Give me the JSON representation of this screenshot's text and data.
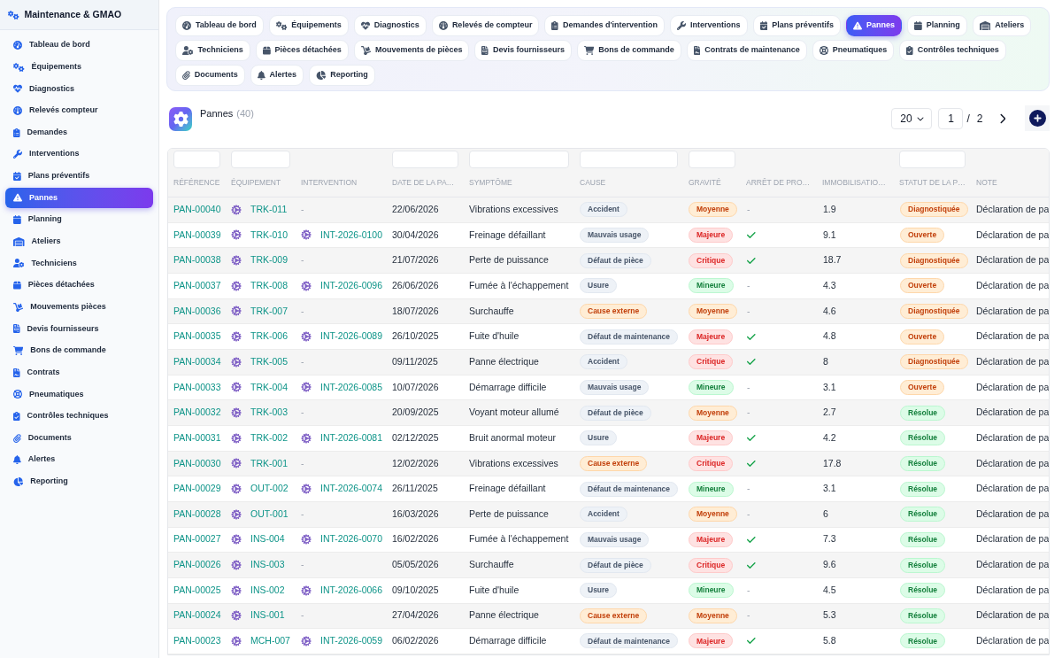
{
  "sidebar": {
    "title": "Maintenance & GMAO",
    "items": [
      {
        "label": "Tableau de bord",
        "selected": false
      },
      {
        "label": "Équipements",
        "selected": false
      },
      {
        "label": "Diagnostics",
        "selected": false
      },
      {
        "label": "Relevés compteur",
        "selected": false
      },
      {
        "label": "Demandes",
        "selected": false
      },
      {
        "label": "Interventions",
        "selected": false
      },
      {
        "label": "Plans préventifs",
        "selected": false
      },
      {
        "label": "Pannes",
        "selected": true
      },
      {
        "label": "Planning",
        "selected": false
      },
      {
        "label": "Ateliers",
        "selected": false
      },
      {
        "label": "Techniciens",
        "selected": false
      },
      {
        "label": "Pièces détachées",
        "selected": false
      },
      {
        "label": "Mouvements pièces",
        "selected": false
      },
      {
        "label": "Devis fournisseurs",
        "selected": false
      },
      {
        "label": "Bons de commande",
        "selected": false
      },
      {
        "label": "Contrats",
        "selected": false
      },
      {
        "label": "Pneumatiques",
        "selected": false
      },
      {
        "label": "Contrôles techniques",
        "selected": false
      },
      {
        "label": "Documents",
        "selected": false
      },
      {
        "label": "Alertes",
        "selected": false
      },
      {
        "label": "Reporting",
        "selected": false
      }
    ]
  },
  "tabs": [
    {
      "label": "Tableau de bord",
      "selected": false
    },
    {
      "label": "Équipements",
      "selected": false
    },
    {
      "label": "Diagnostics",
      "selected": false
    },
    {
      "label": "Relevés de compteur",
      "selected": false
    },
    {
      "label": "Demandes d'intervention",
      "selected": false
    },
    {
      "label": "Interventions",
      "selected": false
    },
    {
      "label": "Plans préventifs",
      "selected": false
    },
    {
      "label": "Pannes",
      "selected": true
    },
    {
      "label": "Planning",
      "selected": false
    },
    {
      "label": "Ateliers",
      "selected": false
    },
    {
      "label": "Techniciens",
      "selected": false
    },
    {
      "label": "Pièces détachées",
      "selected": false
    },
    {
      "label": "Mouvements de pièces",
      "selected": false
    },
    {
      "label": "Devis fournisseurs",
      "selected": false
    },
    {
      "label": "Bons de commande",
      "selected": false
    },
    {
      "label": "Contrats de maintenance",
      "selected": false
    },
    {
      "label": "Pneumatiques",
      "selected": false
    },
    {
      "label": "Contrôles techniques",
      "selected": false
    },
    {
      "label": "Documents",
      "selected": false
    },
    {
      "label": "Alertes",
      "selected": false
    },
    {
      "label": "Reporting",
      "selected": false
    }
  ],
  "page": {
    "title": "Pannes",
    "count": "(40)",
    "page_size": "20",
    "page": "1",
    "separator": "/",
    "total_pages": "2"
  },
  "table": {
    "columns": [
      {
        "label": "RÉFÉRENCE",
        "filter": true
      },
      {
        "label": "ÉQUIPEMENT",
        "filter": true
      },
      {
        "label": "INTERVENTION",
        "filter": false
      },
      {
        "label": "DATE DE LA PA…",
        "filter": true
      },
      {
        "label": "SYMPTÔME",
        "filter": true
      },
      {
        "label": "CAUSE",
        "filter": true
      },
      {
        "label": "GRAVITÉ",
        "filter": true
      },
      {
        "label": "ARRÊT DE PRO…",
        "filter": false
      },
      {
        "label": "IMMOBILISATIO…",
        "filter": false
      },
      {
        "label": "STATUT DE LA P…",
        "filter": true
      },
      {
        "label": "NOTE",
        "filter": false
      }
    ],
    "rows": [
      {
        "reference": "PAN-00040",
        "equipment": "TRK-011",
        "intervention": {
          "kind": "none",
          "text": "-"
        },
        "date": "22/06/2026",
        "symptom": "Vibrations excessives",
        "cause": {
          "text": "Accident",
          "kind": "neutral"
        },
        "severity": {
          "text": "Moyenne",
          "kind": "warning"
        },
        "production_stop": false,
        "production_stop_text": "-",
        "downtime": "1.9",
        "status": {
          "text": "Diagnostiquée",
          "kind": "warning"
        },
        "note": "Déclaration de pa"
      },
      {
        "reference": "PAN-00039",
        "equipment": "TRK-010",
        "intervention": {
          "kind": "link",
          "text": "INT-2026-0100"
        },
        "date": "30/04/2026",
        "symptom": "Freinage défaillant",
        "cause": {
          "text": "Mauvais usage",
          "kind": "neutral"
        },
        "severity": {
          "text": "Majeure",
          "kind": "danger"
        },
        "production_stop": true,
        "downtime": "9.1",
        "status": {
          "text": "Ouverte",
          "kind": "warning"
        },
        "note": "Déclaration de pa"
      },
      {
        "reference": "PAN-00038",
        "equipment": "TRK-009",
        "intervention": {
          "kind": "none",
          "text": "-"
        },
        "date": "21/07/2026",
        "symptom": "Perte de puissance",
        "cause": {
          "text": "Défaut de pièce",
          "kind": "neutral"
        },
        "severity": {
          "text": "Critique",
          "kind": "danger"
        },
        "production_stop": true,
        "downtime": "18.7",
        "status": {
          "text": "Diagnostiquée",
          "kind": "warning"
        },
        "note": "Déclaration de pa"
      },
      {
        "reference": "PAN-00037",
        "equipment": "TRK-008",
        "intervention": {
          "kind": "link",
          "text": "INT-2026-0096"
        },
        "date": "26/06/2026",
        "symptom": "Fumée à l'échappement",
        "cause": {
          "text": "Usure",
          "kind": "neutral"
        },
        "severity": {
          "text": "Mineure",
          "kind": "success"
        },
        "production_stop": false,
        "production_stop_text": "-",
        "downtime": "4.3",
        "status": {
          "text": "Ouverte",
          "kind": "warning"
        },
        "note": "Déclaration de pa"
      },
      {
        "reference": "PAN-00036",
        "equipment": "TRK-007",
        "intervention": {
          "kind": "none",
          "text": "-"
        },
        "date": "18/07/2026",
        "symptom": "Surchauffe",
        "cause": {
          "text": "Cause externe",
          "kind": "warning"
        },
        "severity": {
          "text": "Moyenne",
          "kind": "warning"
        },
        "production_stop": false,
        "production_stop_text": "-",
        "downtime": "4.6",
        "status": {
          "text": "Diagnostiquée",
          "kind": "warning"
        },
        "note": "Déclaration de pa"
      },
      {
        "reference": "PAN-00035",
        "equipment": "TRK-006",
        "intervention": {
          "kind": "link",
          "text": "INT-2026-0089"
        },
        "date": "26/10/2025",
        "symptom": "Fuite d'huile",
        "cause": {
          "text": "Défaut de maintenance",
          "kind": "neutral"
        },
        "severity": {
          "text": "Majeure",
          "kind": "danger"
        },
        "production_stop": true,
        "downtime": "4.8",
        "status": {
          "text": "Ouverte",
          "kind": "warning"
        },
        "note": "Déclaration de pa"
      },
      {
        "reference": "PAN-00034",
        "equipment": "TRK-005",
        "intervention": {
          "kind": "none",
          "text": "-"
        },
        "date": "09/11/2025",
        "symptom": "Panne électrique",
        "cause": {
          "text": "Accident",
          "kind": "neutral"
        },
        "severity": {
          "text": "Critique",
          "kind": "danger"
        },
        "production_stop": true,
        "downtime": "8",
        "status": {
          "text": "Diagnostiquée",
          "kind": "warning"
        },
        "note": "Déclaration de pa"
      },
      {
        "reference": "PAN-00033",
        "equipment": "TRK-004",
        "intervention": {
          "kind": "link",
          "text": "INT-2026-0085"
        },
        "date": "10/07/2026",
        "symptom": "Démarrage difficile",
        "cause": {
          "text": "Mauvais usage",
          "kind": "neutral"
        },
        "severity": {
          "text": "Mineure",
          "kind": "success"
        },
        "production_stop": false,
        "production_stop_text": "-",
        "downtime": "3.1",
        "status": {
          "text": "Ouverte",
          "kind": "warning"
        },
        "note": "Déclaration de pa"
      },
      {
        "reference": "PAN-00032",
        "equipment": "TRK-003",
        "intervention": {
          "kind": "none",
          "text": "-"
        },
        "date": "20/09/2025",
        "symptom": "Voyant moteur allumé",
        "cause": {
          "text": "Défaut de pièce",
          "kind": "neutral"
        },
        "severity": {
          "text": "Moyenne",
          "kind": "warning"
        },
        "production_stop": false,
        "production_stop_text": "-",
        "downtime": "2.7",
        "status": {
          "text": "Résolue",
          "kind": "success"
        },
        "note": "Déclaration de pa"
      },
      {
        "reference": "PAN-00031",
        "equipment": "TRK-002",
        "intervention": {
          "kind": "link",
          "text": "INT-2026-0081"
        },
        "date": "02/12/2025",
        "symptom": "Bruit anormal moteur",
        "cause": {
          "text": "Usure",
          "kind": "neutral"
        },
        "severity": {
          "text": "Majeure",
          "kind": "danger"
        },
        "production_stop": true,
        "downtime": "4.2",
        "status": {
          "text": "Résolue",
          "kind": "success"
        },
        "note": "Déclaration de pa"
      },
      {
        "reference": "PAN-00030",
        "equipment": "TRK-001",
        "intervention": {
          "kind": "none",
          "text": "-"
        },
        "date": "12/02/2026",
        "symptom": "Vibrations excessives",
        "cause": {
          "text": "Cause externe",
          "kind": "warning"
        },
        "severity": {
          "text": "Critique",
          "kind": "danger"
        },
        "production_stop": true,
        "downtime": "17.8",
        "status": {
          "text": "Résolue",
          "kind": "success"
        },
        "note": "Déclaration de pa"
      },
      {
        "reference": "PAN-00029",
        "equipment": "OUT-002",
        "intervention": {
          "kind": "link",
          "text": "INT-2026-0074"
        },
        "date": "26/11/2025",
        "symptom": "Freinage défaillant",
        "cause": {
          "text": "Défaut de maintenance",
          "kind": "neutral"
        },
        "severity": {
          "text": "Mineure",
          "kind": "success"
        },
        "production_stop": false,
        "production_stop_text": "-",
        "downtime": "3.1",
        "status": {
          "text": "Résolue",
          "kind": "success"
        },
        "note": "Déclaration de pa"
      },
      {
        "reference": "PAN-00028",
        "equipment": "OUT-001",
        "intervention": {
          "kind": "none",
          "text": "-"
        },
        "date": "16/03/2026",
        "symptom": "Perte de puissance",
        "cause": {
          "text": "Accident",
          "kind": "neutral"
        },
        "severity": {
          "text": "Moyenne",
          "kind": "warning"
        },
        "production_stop": false,
        "production_stop_text": "-",
        "downtime": "6",
        "status": {
          "text": "Résolue",
          "kind": "success"
        },
        "note": "Déclaration de pa"
      },
      {
        "reference": "PAN-00027",
        "equipment": "INS-004",
        "intervention": {
          "kind": "link",
          "text": "INT-2026-0070"
        },
        "date": "16/02/2026",
        "symptom": "Fumée à l'échappement",
        "cause": {
          "text": "Mauvais usage",
          "kind": "neutral"
        },
        "severity": {
          "text": "Majeure",
          "kind": "danger"
        },
        "production_stop": true,
        "downtime": "7.3",
        "status": {
          "text": "Résolue",
          "kind": "success"
        },
        "note": "Déclaration de pa"
      },
      {
        "reference": "PAN-00026",
        "equipment": "INS-003",
        "intervention": {
          "kind": "none",
          "text": "-"
        },
        "date": "05/05/2026",
        "symptom": "Surchauffe",
        "cause": {
          "text": "Défaut de pièce",
          "kind": "neutral"
        },
        "severity": {
          "text": "Critique",
          "kind": "danger"
        },
        "production_stop": true,
        "downtime": "9.6",
        "status": {
          "text": "Résolue",
          "kind": "success"
        },
        "note": "Déclaration de pa"
      },
      {
        "reference": "PAN-00025",
        "equipment": "INS-002",
        "intervention": {
          "kind": "link",
          "text": "INT-2026-0066"
        },
        "date": "09/10/2025",
        "symptom": "Fuite d'huile",
        "cause": {
          "text": "Usure",
          "kind": "neutral"
        },
        "severity": {
          "text": "Mineure",
          "kind": "success"
        },
        "production_stop": false,
        "production_stop_text": "-",
        "downtime": "4.5",
        "status": {
          "text": "Résolue",
          "kind": "success"
        },
        "note": "Déclaration de pa"
      },
      {
        "reference": "PAN-00024",
        "equipment": "INS-001",
        "intervention": {
          "kind": "none",
          "text": "-"
        },
        "date": "27/04/2026",
        "symptom": "Panne électrique",
        "cause": {
          "text": "Cause externe",
          "kind": "warning"
        },
        "severity": {
          "text": "Moyenne",
          "kind": "warning"
        },
        "production_stop": false,
        "production_stop_text": "-",
        "downtime": "5.3",
        "status": {
          "text": "Résolue",
          "kind": "success"
        },
        "note": "Déclaration de pa"
      },
      {
        "reference": "PAN-00023",
        "equipment": "MCH-007",
        "intervention": {
          "kind": "link",
          "text": "INT-2026-0059"
        },
        "date": "06/02/2026",
        "symptom": "Démarrage difficile",
        "cause": {
          "text": "Défaut de maintenance",
          "kind": "neutral"
        },
        "severity": {
          "text": "Majeure",
          "kind": "danger"
        },
        "production_stop": true,
        "downtime": "5.8",
        "status": {
          "text": "Résolue",
          "kind": "success"
        },
        "note": "Déclaration de pa"
      }
    ]
  }
}
